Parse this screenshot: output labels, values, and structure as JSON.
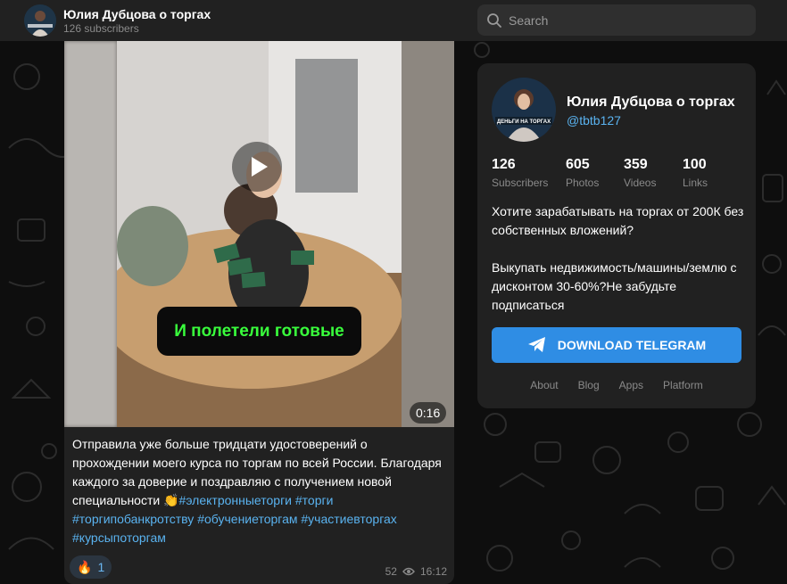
{
  "header": {
    "channel_title": "Юлия Дубцова о торгах",
    "subscribers_text": "126 subscribers",
    "search_placeholder": "Search"
  },
  "post": {
    "video_caption": "И полетели готовые",
    "video_duration": "0:16",
    "text_plain": "Отправила уже больше тридцати удостоверений о прохождении моего курса по торгам по всей России. Благодаря каждого за доверие и поздравляю с получением новой специальности ",
    "emoji": "👏",
    "hashtags": [
      "#электронныеторги",
      "#торги",
      "#торгипобанкротству",
      "#обучениеторгам",
      "#участиевторгах",
      "#курсыпоторгам"
    ],
    "reaction_emoji": "🔥",
    "reaction_count": "1",
    "views": "52",
    "time": "16:12"
  },
  "card": {
    "title": "Юлия Дубцова о торгах",
    "handle": "@tbtb127",
    "avatar_text": "ДЕНЬГИ НА ТОРГАХ",
    "stats": [
      {
        "value": "126",
        "label": "Subscribers"
      },
      {
        "value": "605",
        "label": "Photos"
      },
      {
        "value": "359",
        "label": "Videos"
      },
      {
        "value": "100",
        "label": "Links"
      }
    ],
    "description": "Хотите зарабатывать на торгах от 200К без собственных вложений?\n\nВыкупать недвижимость/машины/землю с дисконтом 30-60%?Не забудьте подписаться",
    "download_label": "DOWNLOAD TELEGRAM",
    "footer_links": [
      "About",
      "Blog",
      "Apps",
      "Platform"
    ]
  },
  "colors": {
    "accent": "#2f8de4",
    "link": "#5ab3f0",
    "panel": "#212121",
    "caption_text": "#39ff3c"
  }
}
